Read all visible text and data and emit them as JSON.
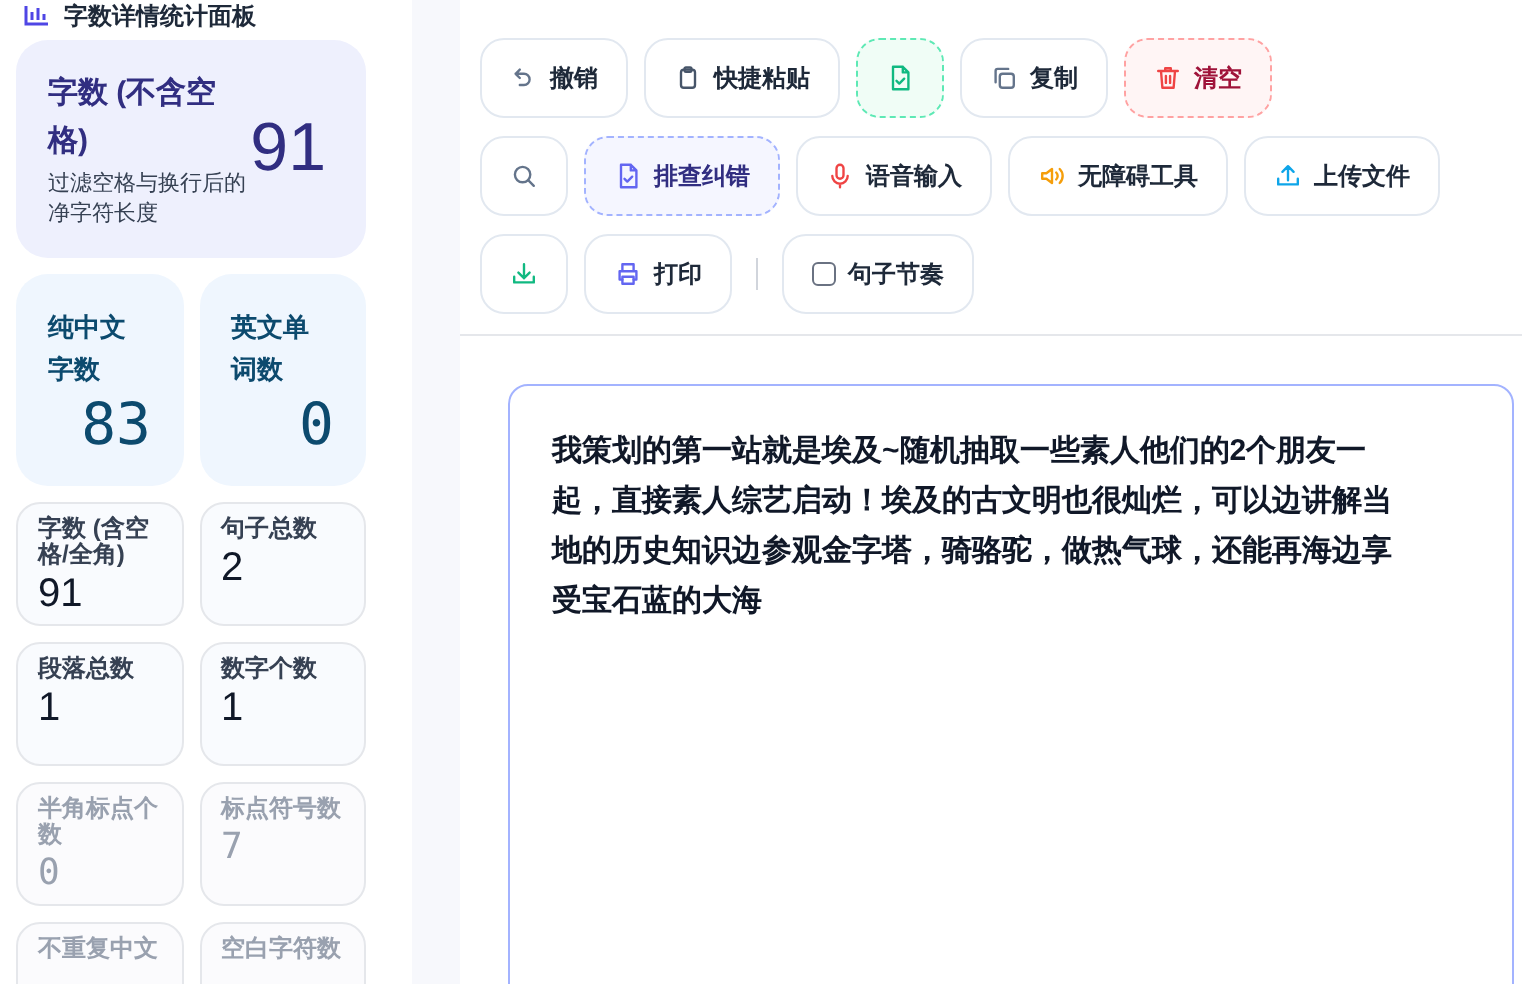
{
  "sidebar": {
    "title": "字数详情统计面板",
    "cards": [
      {
        "kind": "primary",
        "label": "字数 (不含空格)",
        "note": "过滤空格与换行后的净字符长度",
        "value": "91"
      },
      {
        "kind": "medium",
        "label": "纯中文字数",
        "value": "83"
      },
      {
        "kind": "medium",
        "label": "英文单词数",
        "value": "0"
      },
      {
        "kind": "small",
        "label": "字数 (含空格/全角)",
        "value": "91"
      },
      {
        "kind": "small",
        "label": "句子总数",
        "value": "2"
      },
      {
        "kind": "small",
        "label": "段落总数",
        "value": "1"
      },
      {
        "kind": "small",
        "label": "数字个数",
        "value": "1"
      },
      {
        "kind": "muted",
        "label": "半角标点个数",
        "value": "0"
      },
      {
        "kind": "muted",
        "label": "标点符号数",
        "value": "7"
      },
      {
        "kind": "muted",
        "label": "不重复中文"
      },
      {
        "kind": "muted",
        "label": "空白字符数"
      }
    ]
  },
  "toolbar": [
    [
      {
        "kind": "plain",
        "label": "撤销"
      },
      {
        "kind": "plain",
        "label": "快捷粘贴"
      },
      {
        "kind": "dashed-green"
      },
      {
        "kind": "plain",
        "label": "复制"
      },
      {
        "kind": "dashed-red",
        "label": "清空"
      }
    ],
    [
      {
        "kind": "plain"
      },
      {
        "kind": "dashed-indigo",
        "label": "排查纠错"
      },
      {
        "kind": "plain",
        "label": "语音输入"
      },
      {
        "kind": "plain",
        "label": "无障碍工具"
      },
      {
        "kind": "plain",
        "label": "上传文件"
      }
    ],
    [
      {
        "kind": "plain"
      },
      {
        "kind": "plain",
        "label": "打印"
      },
      {
        "kind": "divider"
      },
      {
        "kind": "checkbox",
        "label": "句子节奏",
        "checked": false
      }
    ]
  ],
  "editor": {
    "value": "我策划的第一站就是埃及~随机抽取一些素人他们的2个朋友一起，直接素人综艺启动！埃及的古文明也很灿烂，可以边讲解当地的历史知识边参观金字塔，骑骆驼，做热气球，还能再海边享受宝石蓝的大海"
  }
}
